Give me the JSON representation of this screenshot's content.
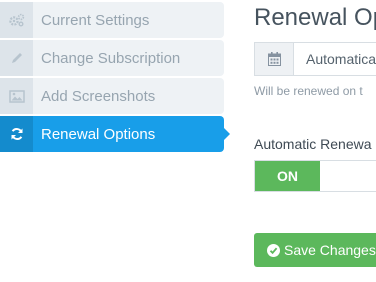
{
  "sidebar": {
    "items": [
      {
        "label": "Current Settings",
        "icon": "gears-icon",
        "active": false
      },
      {
        "label": "Change Subscription",
        "icon": "pencil-icon",
        "active": false
      },
      {
        "label": "Add Screenshots",
        "icon": "image-icon",
        "active": false
      },
      {
        "label": "Renewal Options",
        "icon": "refresh-icon",
        "active": true
      }
    ]
  },
  "main": {
    "title": "Renewal Op",
    "renewal_select": {
      "value": "Automatica",
      "icon": "calendar-icon"
    },
    "help_text": "Will be renewed on t",
    "auto_renew": {
      "label": "Automatic Renewa",
      "state": "ON"
    },
    "save_button": {
      "label": "Save Changes",
      "icon": "check-circle-icon"
    }
  },
  "colors": {
    "accent": "#189ee9",
    "success": "#5cb85c",
    "sidebar_bg": "#eef2f5",
    "text_muted": "#97a5b0"
  }
}
